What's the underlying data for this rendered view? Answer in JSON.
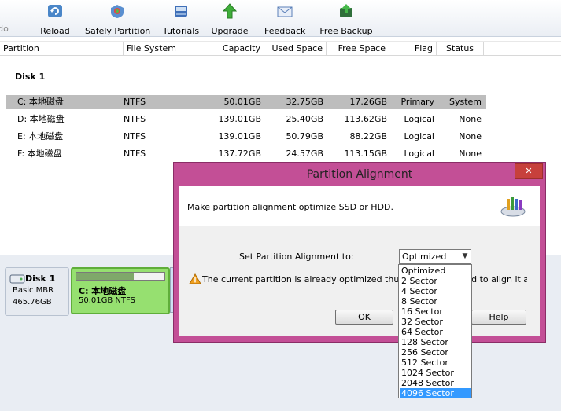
{
  "toolbar": {
    "items": [
      {
        "label": "do"
      },
      {
        "label": "Reload"
      },
      {
        "label": "Safely Partition"
      },
      {
        "label": "Tutorials"
      },
      {
        "label": "Upgrade"
      },
      {
        "label": "Feedback"
      },
      {
        "label": "Free Backup"
      }
    ]
  },
  "list": {
    "headers": {
      "partition": "Partition",
      "file_system": "File System",
      "capacity": "Capacity",
      "used": "Used Space",
      "free": "Free Space",
      "flag": "Flag",
      "status": "Status"
    },
    "disk_label": "Disk 1",
    "rows": [
      {
        "partition": "C: 本地磁盘",
        "fs": "NTFS",
        "capacity": "50.01GB",
        "used": "32.75GB",
        "free": "17.26GB",
        "flag": "Primary",
        "status": "System"
      },
      {
        "partition": "D: 本地磁盘",
        "fs": "NTFS",
        "capacity": "139.01GB",
        "used": "25.40GB",
        "free": "113.62GB",
        "flag": "Logical",
        "status": "None"
      },
      {
        "partition": "E: 本地磁盘",
        "fs": "NTFS",
        "capacity": "139.01GB",
        "used": "50.79GB",
        "free": "88.22GB",
        "flag": "Logical",
        "status": "None"
      },
      {
        "partition": "F: 本地磁盘",
        "fs": "NTFS",
        "capacity": "137.72GB",
        "used": "24.57GB",
        "free": "113.15GB",
        "flag": "Logical",
        "status": "None"
      }
    ]
  },
  "diskmap": {
    "disk": {
      "name": "Disk 1",
      "type": "Basic MBR",
      "size": "465.76GB"
    },
    "partition": {
      "name": "C: 本地磁盘",
      "info": "50.01GB NTFS",
      "used_fraction": 0.65
    }
  },
  "dialog": {
    "title": "Partition Alignment",
    "close_label": "✕",
    "info_text": "Make partition alignment optimize SSD or HDD.",
    "set_label": "Set Partition Alignment to:",
    "selected": "Optimized",
    "warning_text": "The current partition is already optimized thus there is no need to align it again.",
    "ok_label": "OK",
    "help_label": "Help"
  },
  "dropdown": {
    "options": [
      "Optimized",
      "2 Sector",
      "4 Sector",
      "8 Sector",
      "16 Sector",
      "32 Sector",
      "64 Sector",
      "128 Sector",
      "256 Sector",
      "512 Sector",
      "1024 Sector",
      "2048 Sector",
      "4096 Sector"
    ],
    "highlighted": "4096 Sector"
  },
  "colors": {
    "dialog_frame": "#c34f96",
    "selection": "#3399ff",
    "partition_fill": "#96e070"
  }
}
